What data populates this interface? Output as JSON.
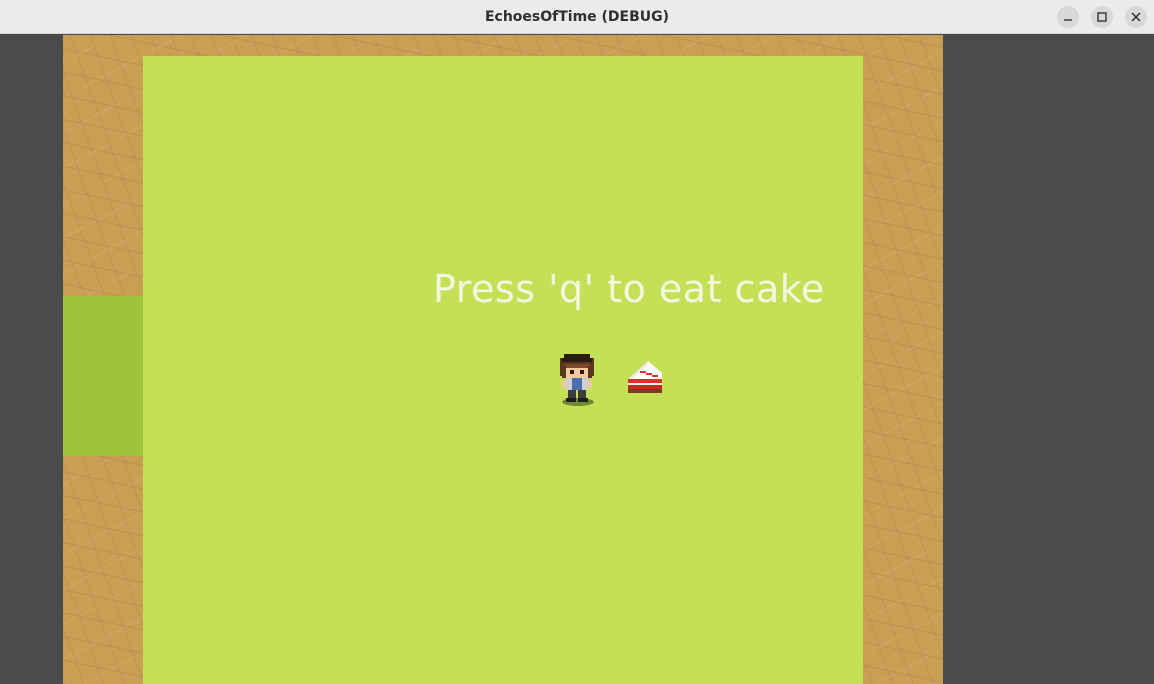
{
  "window": {
    "title": "EchoesOfTime (DEBUG)",
    "minimize_icon": "minimize-icon",
    "maximize_icon": "maximize-icon",
    "close_icon": "close-icon"
  },
  "game": {
    "prompt_text": "Press 'q' to eat cake",
    "entities": [
      "player-character-sprite",
      "cake-slice-sprite"
    ],
    "colors": {
      "grass": "#c4e057",
      "door_grass": "#9ec23a",
      "sand": "#c99f56",
      "background": "#4b4b4b",
      "prompt_text": "#f4f6dd"
    }
  }
}
